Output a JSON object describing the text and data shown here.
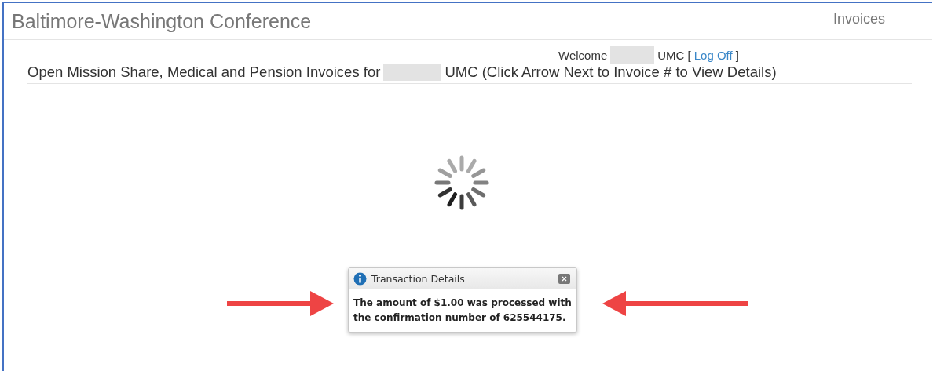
{
  "header": {
    "title": "Baltimore-Washington Conference",
    "nav_link": "Invoices"
  },
  "welcome": {
    "greeting": "Welcome",
    "suffix": "UMC [",
    "logoff": "Log Off",
    "close_bracket": "]"
  },
  "heading": {
    "before": "Open Mission Share, Medical and Pension Invoices for",
    "after": "UMC (Click Arrow Next to Invoice # to View Details)"
  },
  "dialog": {
    "title": "Transaction Details",
    "message": "The amount of $1.00 was processed with the confirmation number of 625544175."
  }
}
